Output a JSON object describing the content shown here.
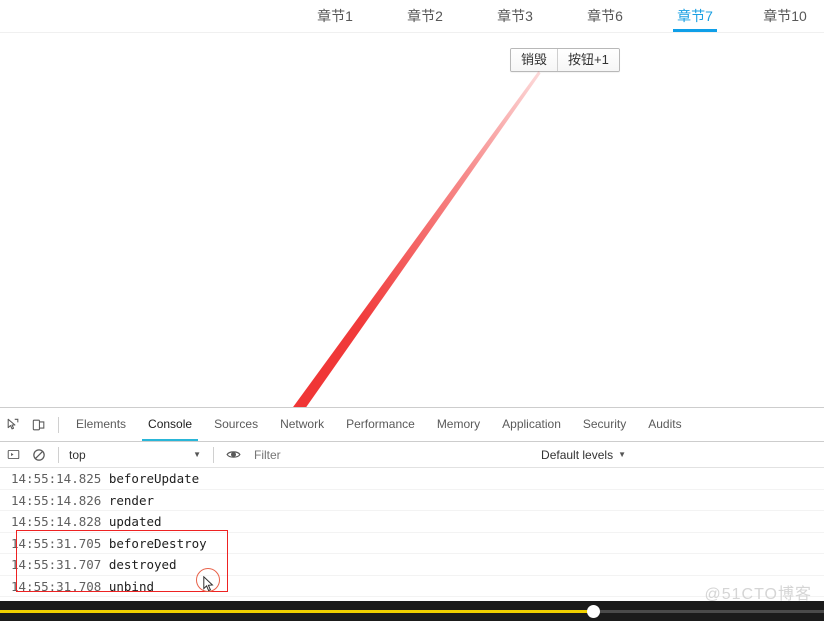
{
  "page": {
    "nav": {
      "tabs": [
        {
          "label": "章节1",
          "active": false
        },
        {
          "label": "章节2",
          "active": false
        },
        {
          "label": "章节3",
          "active": false
        },
        {
          "label": "章节6",
          "active": false
        },
        {
          "label": "章节7",
          "active": true
        },
        {
          "label": "章节10",
          "active": false
        }
      ],
      "active_color": "#0f9fe8",
      "inactive_color": "#585858"
    },
    "buttons": {
      "destroy_label": "销毁",
      "counter_label": "按钮+1"
    },
    "annotation": {
      "arrow_color": "#f03030",
      "highlight_box_color": "#ee2222",
      "highlight_circle_color": "#e8624a"
    },
    "watermark": "@51CTO博客"
  },
  "devtools": {
    "left_icons": [
      {
        "name": "inspect-element-icon",
        "title": "Inspect"
      },
      {
        "name": "device-toolbar-icon",
        "title": "Toggle device toolbar"
      }
    ],
    "panels": [
      {
        "label": "Elements",
        "active": false
      },
      {
        "label": "Console",
        "active": true
      },
      {
        "label": "Sources",
        "active": false
      },
      {
        "label": "Network",
        "active": false
      },
      {
        "label": "Performance",
        "active": false
      },
      {
        "label": "Memory",
        "active": false
      },
      {
        "label": "Application",
        "active": false
      },
      {
        "label": "Security",
        "active": false
      },
      {
        "label": "Audits",
        "active": false
      }
    ],
    "active_panel_underline": "#29b6d8",
    "console_toolbar": {
      "sidebar_toggle_name": "console-sidebar-toggle-icon",
      "clear_console_name": "clear-console-icon",
      "context_value": "top",
      "context_caret": "▼",
      "eye_icon_name": "live-expression-eye-icon",
      "filter_placeholder": "Filter",
      "filter_value": "",
      "levels_label": "Default levels",
      "levels_caret": "▼"
    },
    "console_rows": [
      {
        "time": "14:55:14.825",
        "message": "beforeUpdate"
      },
      {
        "time": "14:55:14.826",
        "message": "render"
      },
      {
        "time": "14:55:14.828",
        "message": "updated"
      },
      {
        "time": "14:55:31.705",
        "message": "beforeDestroy"
      },
      {
        "time": "14:55:31.707",
        "message": "destroyed"
      },
      {
        "time": "14:55:31.708",
        "message": "unbind"
      }
    ]
  },
  "video_player": {
    "progress_percent": 72,
    "track_color": "#4a4a4a",
    "progress_color": "#f0d000",
    "handle_color": "#ffffff",
    "bar_color": "#1b1b1b"
  }
}
